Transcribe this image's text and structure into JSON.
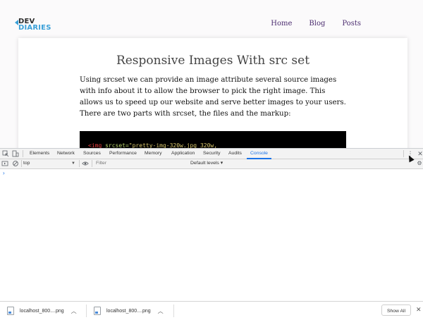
{
  "site": {
    "logo": {
      "line1": "DEV",
      "line2": "DIARIES"
    },
    "nav": [
      "Home",
      "Blog",
      "Posts"
    ],
    "article": {
      "title": "Responsive Images With src set",
      "paragraph": "Using srcset we can provide an image attribute several source images with info about it to allow the browser to pick the right image. This allows us to speed up our website and serve better images to your users. There are two parts with srcset, the files and the markup:",
      "code": {
        "tag": "<img",
        "attr": " srcset=",
        "value": "\"pretty-img-320w.jpg 320w,"
      }
    }
  },
  "devtools": {
    "tabs": [
      "Elements",
      "Network",
      "Sources",
      "Performance",
      "Memory",
      "Application",
      "Security",
      "Audits",
      "Console"
    ],
    "active_tab": "Console",
    "context": "top",
    "filter_placeholder": "Filter",
    "levels_label": "Default levels ▾",
    "prompt": "›",
    "accent": "#1a73e8"
  },
  "downloads": {
    "items": [
      {
        "name": "localhost_800....png"
      },
      {
        "name": "localhost_800....png"
      }
    ],
    "show_all": "Show All"
  }
}
